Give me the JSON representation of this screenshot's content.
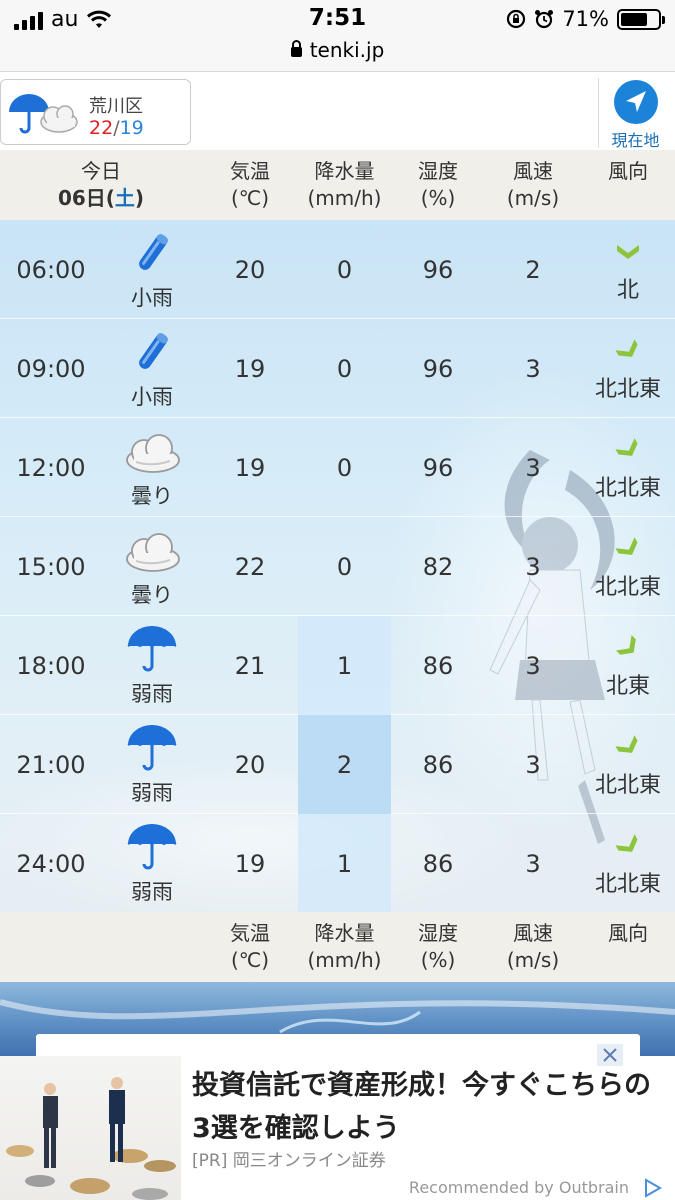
{
  "status_bar": {
    "carrier": "au",
    "time": "7:51",
    "battery": "71%",
    "battery_level": 0.71
  },
  "browser": {
    "url": "tenki.jp"
  },
  "location": {
    "name": "荒川区",
    "high": "22",
    "sep": "/",
    "low": "19",
    "weather_icon": "umbrella-cloud-icon",
    "current_location_label": "現在地"
  },
  "table": {
    "header": {
      "day": "今日",
      "date_prefix": "06日(",
      "weekday": "土",
      "date_suffix": ")",
      "temp": "気温",
      "temp_unit": "(℃)",
      "precip": "降水量",
      "precip_unit": "(mm/h)",
      "humidity": "湿度",
      "humidity_unit": "(%)",
      "wind_speed": "風速",
      "wind_speed_unit": "(m/s)",
      "wind_dir": "風向"
    },
    "rows": [
      {
        "time": "06:00",
        "weather": "小雨",
        "icon": "light-rain-icon",
        "temp": "20",
        "precip": "0",
        "humidity": "96",
        "wind_speed": "2",
        "wind_dir": "北"
      },
      {
        "time": "09:00",
        "weather": "小雨",
        "icon": "light-rain-icon",
        "temp": "19",
        "precip": "0",
        "humidity": "96",
        "wind_speed": "3",
        "wind_dir": "北北東"
      },
      {
        "time": "12:00",
        "weather": "曇り",
        "icon": "cloud-icon",
        "temp": "19",
        "precip": "0",
        "humidity": "96",
        "wind_speed": "3",
        "wind_dir": "北北東"
      },
      {
        "time": "15:00",
        "weather": "曇り",
        "icon": "cloud-icon",
        "temp": "22",
        "precip": "0",
        "humidity": "82",
        "wind_speed": "3",
        "wind_dir": "北北東"
      },
      {
        "time": "18:00",
        "weather": "弱雨",
        "icon": "umbrella-icon",
        "temp": "21",
        "precip": "1",
        "humidity": "86",
        "wind_speed": "3",
        "wind_dir": "北東"
      },
      {
        "time": "21:00",
        "weather": "弱雨",
        "icon": "umbrella-icon",
        "temp": "20",
        "precip": "2",
        "humidity": "86",
        "wind_speed": "3",
        "wind_dir": "北北東"
      },
      {
        "time": "24:00",
        "weather": "弱雨",
        "icon": "umbrella-icon",
        "temp": "19",
        "precip": "1",
        "humidity": "86",
        "wind_speed": "3",
        "wind_dir": "北北東"
      }
    ]
  },
  "ad": {
    "title": "投資信託で資産形成！今すぐこちらの3選を確認しよう",
    "source": "[PR] 岡三オンライン証券",
    "recommended": "Recommended by Outbrain"
  },
  "colors": {
    "accent": "#1b84d8",
    "high_temp": "#e02020",
    "low_temp": "#2a86d9",
    "wind_arrow": "#8cc43c"
  }
}
